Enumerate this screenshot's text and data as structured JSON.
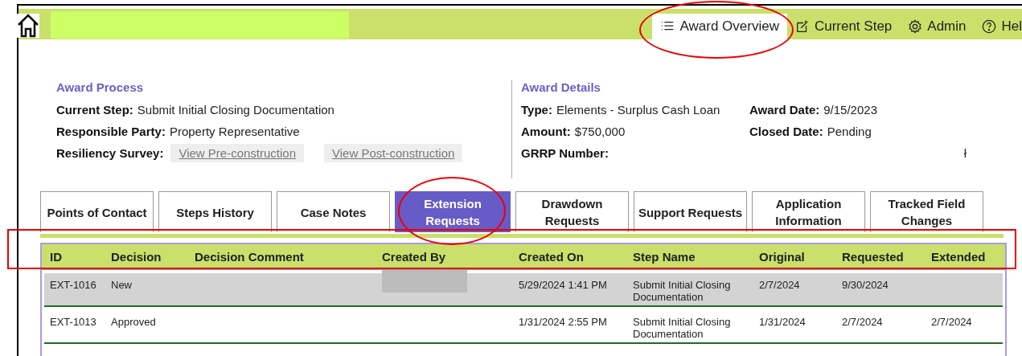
{
  "header": {
    "title_redacted": true,
    "nav": [
      {
        "label": "Award Overview",
        "selected": true,
        "circled": true
      },
      {
        "label": "Current Step",
        "selected": false,
        "circled": false
      },
      {
        "label": "Admin",
        "selected": false,
        "circled": false
      },
      {
        "label": "Hel",
        "selected": false,
        "circled": false
      }
    ]
  },
  "award_process": {
    "title": "Award Process",
    "fields": [
      {
        "kind": "text",
        "label": "Current Step:",
        "value": "Submit Initial Closing Documentation"
      },
      {
        "kind": "text",
        "label": "Responsible Party:",
        "value": "Property Representative"
      },
      {
        "kind": "links",
        "label": "Resiliency Survey:",
        "links": [
          "View Pre-construction",
          "View Post-construction"
        ]
      }
    ]
  },
  "award_details": {
    "title": "Award Details",
    "fields": [
      {
        "label": "Type:",
        "value": "Elements - Surplus Cash Loan"
      },
      {
        "label": "Award Date:",
        "value": "9/15/2023"
      },
      {
        "label": "Amount:",
        "value": "$750,000"
      },
      {
        "label": "Closed Date:",
        "value": "Pending"
      },
      {
        "label": "GRRP Number:",
        "value": "ł"
      }
    ]
  },
  "tabs": [
    {
      "label": "Points of Contact",
      "selected": false,
      "circled": false
    },
    {
      "label": "Steps History",
      "selected": false,
      "circled": false
    },
    {
      "label": "Case Notes",
      "selected": false,
      "circled": false
    },
    {
      "label": "Extension Requests",
      "selected": true,
      "circled": true
    },
    {
      "label": "Drawdown Requests",
      "selected": false,
      "circled": false
    },
    {
      "label": "Support Requests",
      "selected": false,
      "circled": false
    },
    {
      "label": "Application Information",
      "selected": false,
      "circled": false
    },
    {
      "label": "Tracked Field Changes",
      "selected": false,
      "circled": false
    }
  ],
  "table": {
    "header_boxed": true,
    "columns": [
      "ID",
      "Decision",
      "Decision Comment",
      "Created By",
      "Created On",
      "Step Name",
      "Original",
      "Requested",
      "Extended"
    ],
    "rows": [
      {
        "selected": true,
        "created_by_redacted": true,
        "cells": [
          "EXT-1016",
          "New",
          "",
          "",
          "5/29/2024 1:41 PM",
          "Submit Initial Closing Documentation",
          "2/7/2024",
          "9/30/2024",
          ""
        ]
      },
      {
        "selected": false,
        "created_by_redacted": false,
        "cells": [
          "EXT-1013",
          "Approved",
          "",
          "",
          "1/31/2024 2:55 PM",
          "Submit Initial Closing Documentation",
          "1/31/2024",
          "2/7/2024",
          "2/7/2024"
        ]
      }
    ]
  }
}
